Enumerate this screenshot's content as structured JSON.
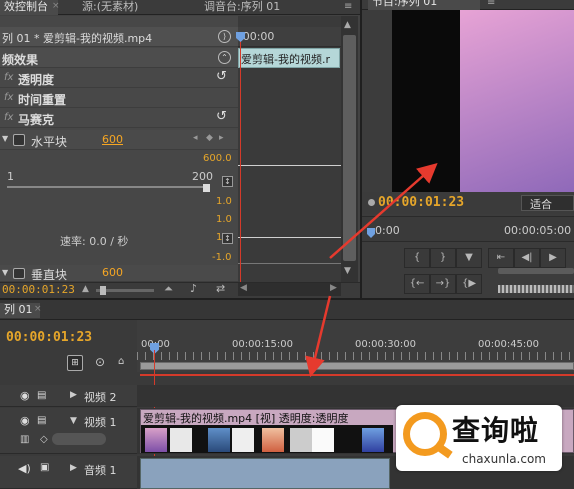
{
  "effect_controls": {
    "tabs": [
      "效控制台",
      "源:(无素材)",
      "调音台:序列 01"
    ],
    "sequence_clip": "列 01 * 爱剪辑-我的视频.mp4",
    "section_title": "频效果",
    "ruler_time": ":00:00",
    "clip_block": "爱剪辑-我的视频.r",
    "effects": [
      {
        "label": "透明度"
      },
      {
        "label": "时间重置"
      },
      {
        "label": "马赛克"
      }
    ],
    "horizontal_blocks": {
      "label": "水平块",
      "value": "600"
    },
    "vertical_blocks": {
      "label": "垂直块",
      "value": "600"
    },
    "slider_min": "1",
    "slider_max": "200",
    "graph_values": [
      "600.0",
      "1.0",
      "1.0",
      "1.0",
      "-1.0"
    ],
    "rate_label": "速率: 0.0 / 秒",
    "current_time": "00:00:01:23"
  },
  "program_monitor": {
    "tab": "节目:序列 01",
    "timecode": "00:00:01:23",
    "fit_label": "适合",
    "ruler_start": "0:00",
    "ruler_mid": "00:00:05:00",
    "accent_gradient": [
      "#e7a3d5",
      "#8f69b9"
    ]
  },
  "timeline": {
    "tab": "列 01",
    "timecode": "00:00:01:23",
    "ruler_labels": [
      "00:00",
      "00:00:15:00",
      "00:00:30:00",
      "00:00:45:00"
    ],
    "tracks": [
      {
        "name": "视频 2"
      },
      {
        "name": "视频 1"
      },
      {
        "name": "音频 1"
      }
    ],
    "clip_title": "爱剪辑-我的视频.mp4 [视] 透明度:透明度"
  },
  "watermark": {
    "text": "查询啦",
    "url": "chaxunla.com",
    "brand_color": "#f39a1f"
  },
  "colors": {
    "arrow": "#e63a2e",
    "timecode": "#e6a62a",
    "playhead": "#d43a2a"
  }
}
